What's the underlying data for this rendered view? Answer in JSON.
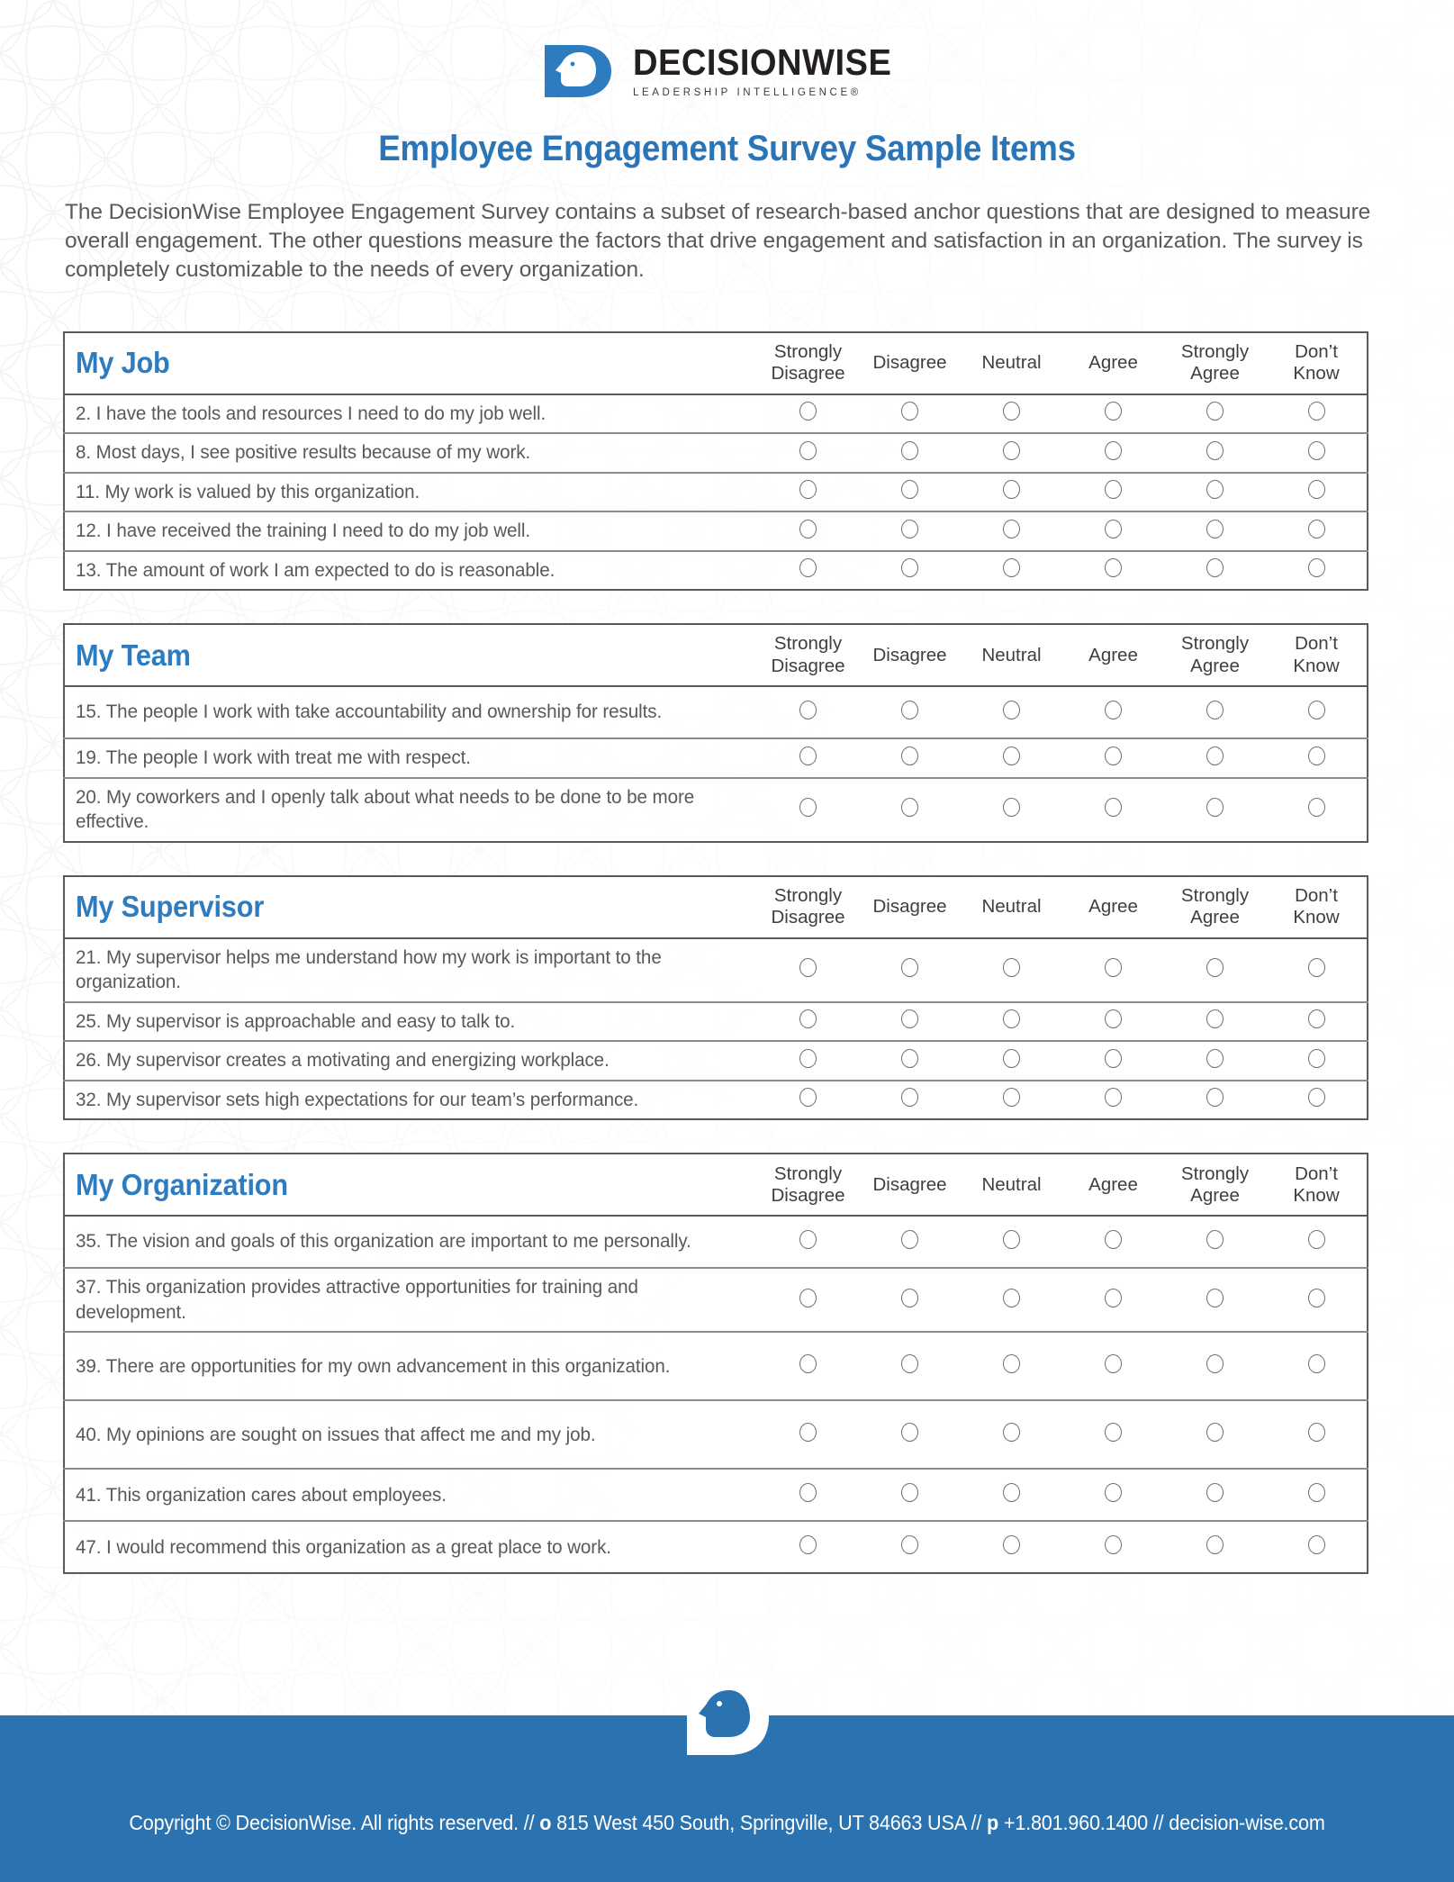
{
  "brand": {
    "logo_word_part1": "DECISION",
    "logo_word_part2": "WISE",
    "logo_tagline": "LEADERSHIP INTELLIGENCE®",
    "logo_icon": "decisionwise-face-d-logo",
    "accent_blue": "#2a75b8",
    "heading_blue": "#2e7cc0",
    "footer_blue": "#2a73b0"
  },
  "document": {
    "title": "Employee Engagement Survey Sample Items",
    "intro": "The DecisionWise Employee Engagement Survey contains a subset of research-based anchor questions that are designed to measure overall engagement. The other questions measure the factors that drive engagement and satisfaction in an organization. The survey is completely customizable to the needs of every organization."
  },
  "scale": {
    "options": [
      "Strongly Disagree",
      "Disagree",
      "Neutral",
      "Agree",
      "Strongly Agree",
      "Don’t Know"
    ],
    "labels_two_line": [
      [
        "Strongly",
        "Disagree"
      ],
      [
        "Disagree",
        ""
      ],
      [
        "Neutral",
        ""
      ],
      [
        "Agree",
        ""
      ],
      [
        "Strongly",
        "Agree"
      ],
      [
        "Don’t",
        "Know"
      ]
    ]
  },
  "sections": [
    {
      "id": "my-job",
      "title": "My Job",
      "questions": [
        {
          "number": "2.",
          "text": "2. I have the tools and resources I need to do my job well.",
          "lines": 1
        },
        {
          "number": "8.",
          "text": "8. Most days, I see positive results because of my work.",
          "lines": 1
        },
        {
          "number": "11.",
          "text": "11. My work is valued by this organization.",
          "lines": 1
        },
        {
          "number": "12.",
          "text": "12. I have received the training I need to do my job well.",
          "lines": 1
        },
        {
          "number": "13.",
          "text": "13. The amount of work I am expected to do is reasonable.",
          "lines": 1
        }
      ]
    },
    {
      "id": "my-team",
      "title": "My Team",
      "questions": [
        {
          "number": "15.",
          "text": "15. The people I work with take accountability and ownership for results.",
          "lines": 2
        },
        {
          "number": "19.",
          "text": "19. The people I work with treat me with respect.",
          "lines": 1
        },
        {
          "number": "20.",
          "text": "20. My coworkers and I openly talk about what needs to be done to be more effective.",
          "lines": 2
        }
      ]
    },
    {
      "id": "my-supervisor",
      "title": "My Supervisor",
      "questions": [
        {
          "number": "21.",
          "text": "21. My supervisor helps me understand how my work is important to the organization.",
          "lines": 2
        },
        {
          "number": "25.",
          "text": "25. My supervisor is approachable and easy to talk to.",
          "lines": 1
        },
        {
          "number": "26.",
          "text": "26. My supervisor creates a motivating and energizing workplace.",
          "lines": 1
        },
        {
          "number": "32.",
          "text": "32. My supervisor sets high expectations for our team’s performance.",
          "lines": 1
        }
      ]
    },
    {
      "id": "my-organization",
      "title": "My Organization",
      "questions": [
        {
          "number": "35.",
          "text": "35. The vision and goals of this organization are important to me personally.",
          "lines": 2
        },
        {
          "number": "37.",
          "text": "37. This organization provides attractive opportunities for training and development.",
          "lines": 2
        },
        {
          "number": "39.",
          "text": "39. There are opportunities for my own advancement in this organization.",
          "lines": 3
        },
        {
          "number": "40.",
          "text": "40. My opinions are sought on issues that affect me and my job.",
          "lines": 3
        },
        {
          "number": "41.",
          "text": "41. This organization cares about employees.",
          "lines": 2
        },
        {
          "number": "47.",
          "text": "47. I would recommend this organization as a great place to work.",
          "lines": 2
        }
      ]
    }
  ],
  "footer": {
    "copyright": "Copyright © DecisionWise. All rights reserved. // ",
    "office_label": "o",
    "address": " 815 West 450 South, Springville, UT 84663 USA // ",
    "phone_label": "p",
    "phone": " +1.801.960.1400 // decision-wise.com",
    "logo_icon": "decisionwise-face-d-logo-inverse"
  }
}
